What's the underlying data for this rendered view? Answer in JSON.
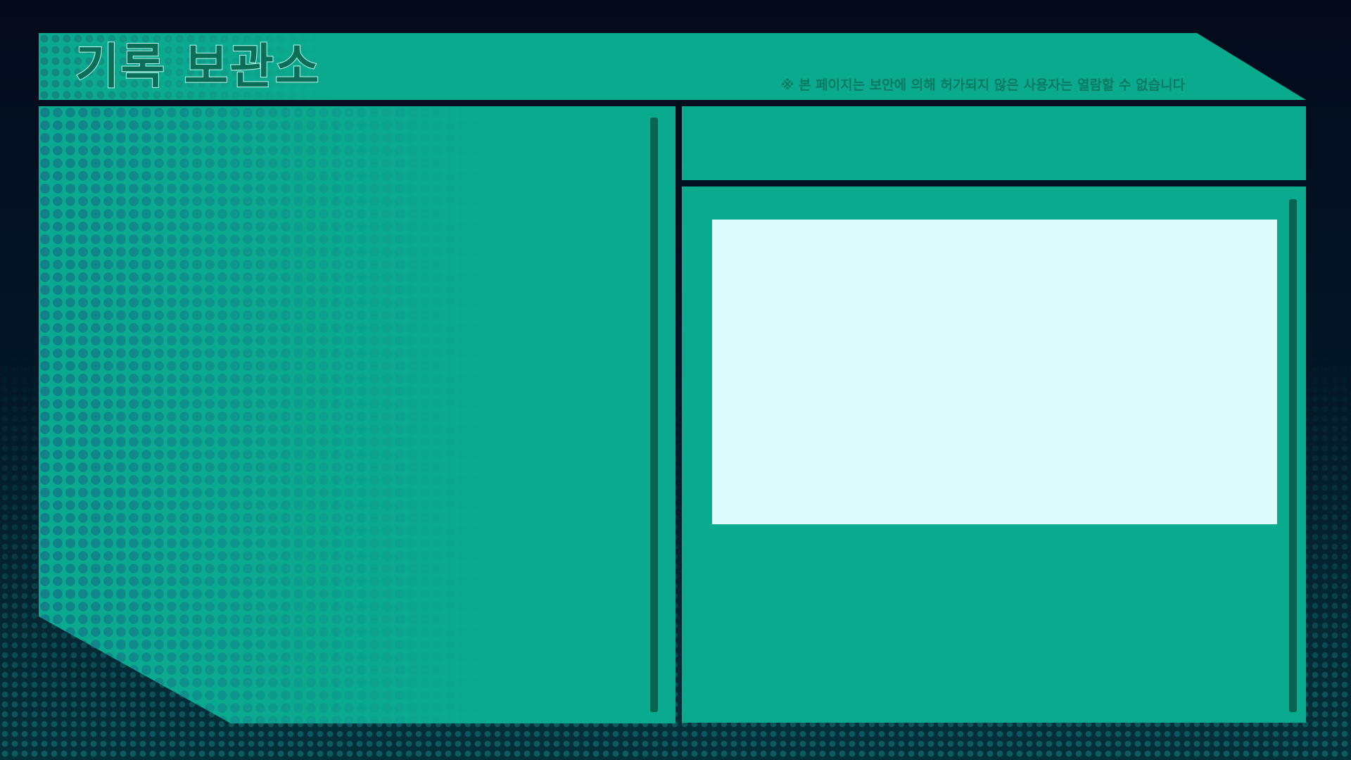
{
  "header": {
    "title": "기록 보관소",
    "notice": "※ 본 페이지는 보안에 의해 허가되지 않은 사용자는 열람할 수 없습니다"
  },
  "colors": {
    "background": "#030a1c",
    "panel": "#0aaa8e",
    "panel_dots": "#13808a",
    "scrollbar": "#05654f",
    "content_box": "#dcfcfe",
    "title_fill": "#0a6e58",
    "notice_text": "#0a7b62"
  }
}
